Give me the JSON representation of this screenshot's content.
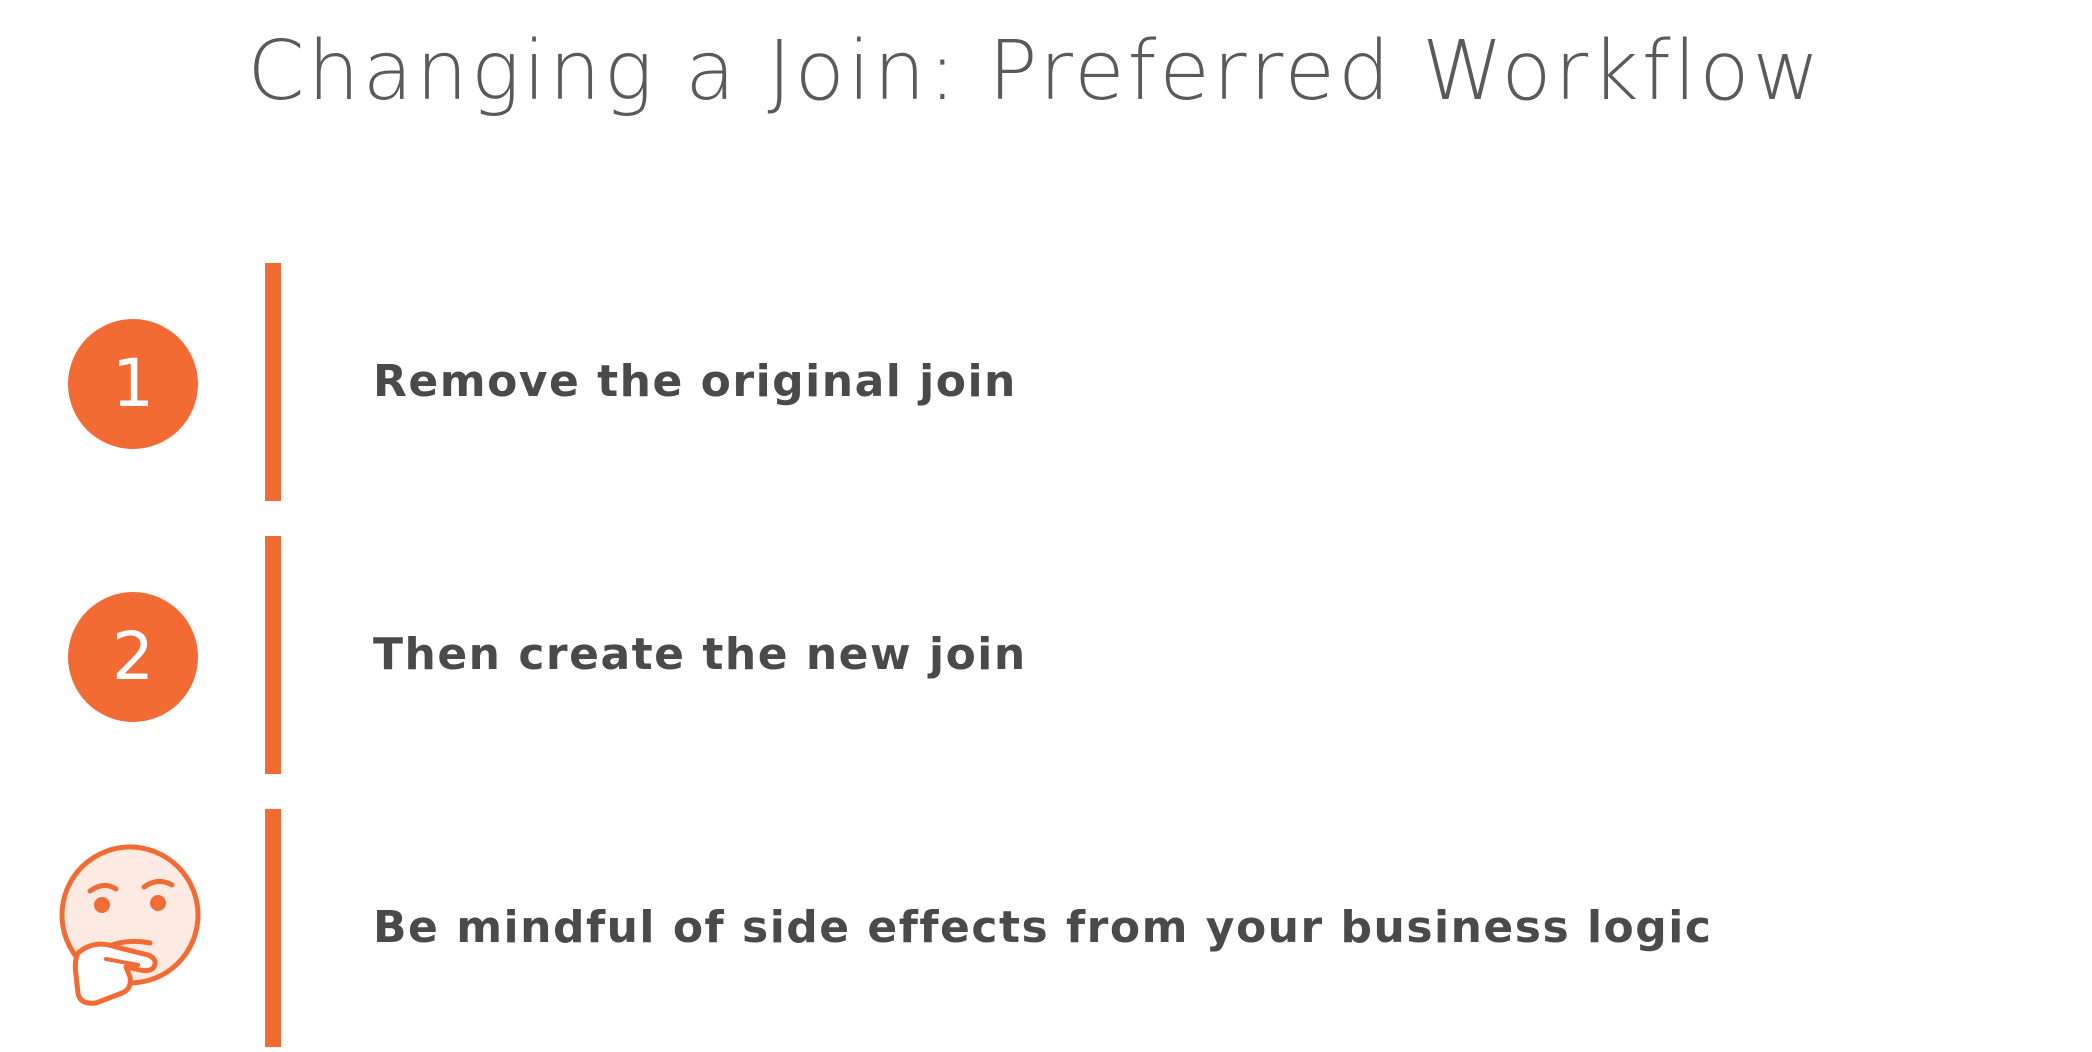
{
  "title": "Changing a Join: Preferred Workflow",
  "accent_color": "#f26b35",
  "text_color": "#4a4a4a",
  "steps": [
    {
      "badge": "1",
      "text": "Remove the original join"
    },
    {
      "badge": "2",
      "text": "Then create the new join"
    },
    {
      "icon": "thinking-face-icon",
      "text": "Be mindful of side effects from your business logic"
    }
  ]
}
